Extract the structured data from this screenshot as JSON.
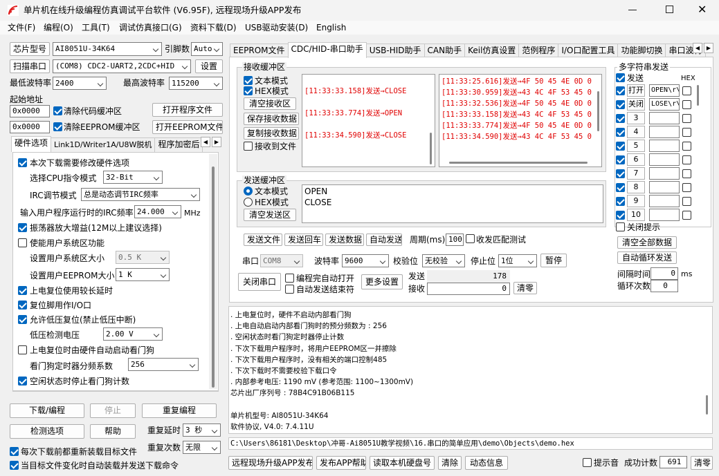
{
  "title": "单片机在线升级编程仿真调试平台软件 (V6.95F), 远程现场升级APP发布",
  "menu": [
    "文件(F)",
    "编程(O)",
    "工具(T)",
    "调试仿真接口(G)",
    "资料下载(D)",
    "USB驱动安装(D)",
    "English"
  ],
  "left": {
    "chip_label": "芯片型号",
    "chip_value": "AI8051U-34K64",
    "pin_label": "引脚数",
    "pin_value": "Auto",
    "scan_label": "扫描串口",
    "port_value": "(COM8) CDC2-UART2,2CDC+HID",
    "settings_label": "设置",
    "min_baud_label": "最低波特率",
    "min_baud_value": "2400",
    "max_baud_label": "最高波特率",
    "max_baud_value": "115200",
    "start_addr_label": "起始地址",
    "addr1": "0x0000",
    "clear_code": "清除代码缓冲区",
    "open_prog": "打开程序文件",
    "addr2": "0x0000",
    "clear_eeprom": "清除EEPROM缓冲区",
    "open_eeprom": "打开EEPROM文件",
    "tabs": [
      "硬件选项",
      "Link1D/Writer1A/U8W脱机",
      "程序加密后"
    ],
    "hw": {
      "modify_hw": "本次下载需要修改硬件选项",
      "cpu_label": "选择CPU指令模式",
      "cpu_value": "32-Bit",
      "irc_mode_label": "IRC调节模式",
      "irc_mode_value": "总是动态调节IRC频率",
      "irc_freq_label": "输入用户程序运行时的IRC频率",
      "irc_freq_value": "24.000",
      "mhz": "MHz",
      "osc_gain": "振荡器放大增益(12M以上建议选择)",
      "user_sys": "使能用户系统区功能",
      "user_sys_size_label": "设置用户系统区大小",
      "user_sys_size_value": "0.5 K",
      "user_eeprom_label": "设置用户EEPROM大小",
      "user_eeprom_value": "1   K",
      "por_delay": "上电复位使用较长延时",
      "reset_io": "复位脚用作I/O口",
      "lvr": "允许低压复位(禁止低压中断)",
      "lvd_label": "低压检测电压",
      "lvd_value": "2.00 V",
      "wdt_hw": "上电复位时由硬件自动启动看门狗",
      "wdt_div_label": "看门狗定时器分频系数",
      "wdt_div_value": "256",
      "idle_wdt": "空闲状态时停止看门狗计数"
    },
    "download": "下载/编程",
    "stop": "停止",
    "reprogram": "重复编程",
    "check_opts": "检测选项",
    "help": "帮助",
    "repeat_delay_label": "重复延时",
    "repeat_delay_value": "3 秒",
    "repeat_count_label": "重复次数",
    "repeat_count_value": "无限",
    "reload_each": "每次下载前都重新装载目标文件",
    "auto_reload": "当目标文件变化时自动装载并发送下载命令"
  },
  "right_tabs": [
    "EEPROM文件",
    "CDC/HID-串口助手",
    "USB-HID助手",
    "CAN助手",
    "Keil仿真设置",
    "范例程序",
    "I/O口配置工具",
    "功能脚切换",
    "串口波特"
  ],
  "serial": {
    "rx_title": "接收缓冲区",
    "text_mode": "文本模式",
    "hex_mode": "HEX模式",
    "clear_rx": "清空接收区",
    "save_rx": "保存接收数据",
    "copy_rx": "复制接收数据",
    "rx_to_file": "接收到文件",
    "rx_text": [
      "[11:33:33.158]发送→CLOSE",
      "[11:33:33.774]发送→OPEN",
      "[11:33:34.590]发送→CLOSE"
    ],
    "rx_hex": [
      "[11:33:25.616]发送→4F 50 45 4E 0D 0",
      "[11:33:30.959]发送→43 4C 4F 53 45 0",
      "[11:33:32.536]发送→4F 50 45 4E 0D 0",
      "[11:33:33.158]发送→43 4C 4F 53 45 0",
      "[11:33:33.774]发送→4F 50 45 4E 0D 0",
      "[11:33:34.590]发送→43 4C 4F 53 45 0"
    ],
    "tx_title": "发送缓冲区",
    "tx_text_mode": "文本模式",
    "tx_hex_mode": "HEX模式",
    "clear_tx": "清空发送区",
    "tx_lines": [
      "OPEN",
      "CLOSE"
    ],
    "send_file": "发送文件",
    "send_cr": "发送回车",
    "send_data": "发送数据",
    "auto_send": "自动发送",
    "period_label": "周期(ms)",
    "period_value": "100",
    "match_test": "收发匹配测试",
    "port_label": "串口",
    "port_value": "COM8",
    "baud_label": "波特率",
    "baud_value": "9600",
    "parity_label": "校验位",
    "parity_value": "无校验",
    "stopbit_label": "停止位",
    "stopbit_value": "1位",
    "pause": "暂停",
    "close_port": "关闭串口",
    "auto_open": "编程完自动打开",
    "auto_send_end": "自动发送结束符",
    "more_settings": "更多设置",
    "sent_label": "发送",
    "sent_value": "178",
    "recv_label": "接收",
    "recv_value": "0",
    "clear_count": "清零"
  },
  "multi": {
    "title": "多字符串发送",
    "send_label": "发送",
    "hex_label": "HEX",
    "rows": [
      {
        "btn": "打开",
        "value": "OPEN\\r\\"
      },
      {
        "btn": "关闭",
        "value": "LOSE\\r\\"
      },
      {
        "btn": "3",
        "value": ""
      },
      {
        "btn": "4",
        "value": ""
      },
      {
        "btn": "5",
        "value": ""
      },
      {
        "btn": "6",
        "value": ""
      },
      {
        "btn": "7",
        "value": ""
      },
      {
        "btn": "8",
        "value": ""
      },
      {
        "btn": "9",
        "value": ""
      },
      {
        "btn": "10",
        "value": ""
      }
    ],
    "close_hint": "关闭提示",
    "clear_all": "清空全部数据",
    "auto_loop": "自动循环发送",
    "interval_label": "间隔时间",
    "interval_value": "0",
    "ms": "ms",
    "loop_label": "循环次数",
    "loop_value": "0"
  },
  "info_lines": [
    "  . 上电复位时，硬件不启动内部看门狗",
    "  . 上电自动启动内部看门狗时的预分频数为 : 256",
    "  . 空闲状态时看门狗定时器停止计数",
    "  . 下次下载用户程序时，将用户EEPROM区一并擦除",
    "  . 下次下载用户程序时，没有相关的端口控制485",
    "  . 下次下载时不需要校验下载口令",
    "  . 内部参考电压: 1190 mV (参考范围: 1100~1300mV)",
    "芯片出厂序列号 : 78B4C91B06B115",
    "",
    "  单片机型号: AI8051U-34K64",
    "  软件协议, V4.0: 7.4.11U"
  ],
  "path": "C:\\Users\\86181\\Desktop\\冲哥-Ai8051U教学视频\\16.串口的简单应用\\demo\\Objects\\demo.hex",
  "bottom": {
    "publish": "远程现场升级APP发布",
    "publish_help": "发布APP帮助",
    "read_disk": "读取本机硬盘号",
    "clear": "清除",
    "dynamic": "动态信息",
    "beep": "提示音",
    "success_label": "成功计数",
    "success_value": "691",
    "reset": "清零"
  }
}
